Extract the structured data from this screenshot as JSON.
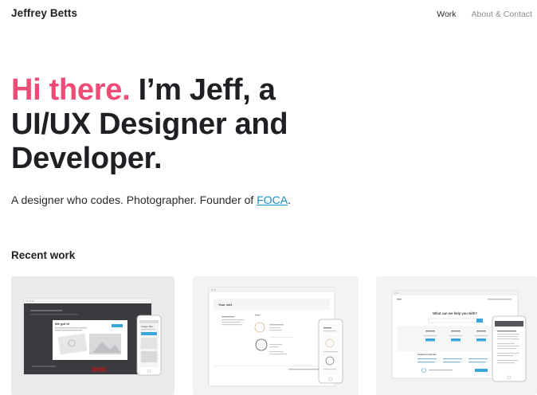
{
  "header": {
    "brand": "Jeffrey Betts",
    "nav": [
      {
        "label": "Work"
      },
      {
        "label": "About & Contact"
      }
    ]
  },
  "hero": {
    "greeting": "Hi there.",
    "line1_rest": " I’m Jeff, a",
    "line2": "UI/UX Designer and",
    "line3": "Developer."
  },
  "tagline": {
    "prefix": "A designer who codes. Photographer. Founder of ",
    "link": "FOCA",
    "suffix": "."
  },
  "recent": {
    "title": "Recent work",
    "projects": [
      {
        "mock_heading": "We got it!",
        "mock_subheading": "Image Title"
      },
      {
        "mock_heading": "Your cart"
      },
      {
        "mock_heading": "What can we help you with?",
        "mock_subheading": "Featured articles"
      }
    ]
  },
  "colors": {
    "accent": "#ee4c76",
    "link": "#1a8fc4",
    "text": "#1f1f24",
    "muted": "#8e8e93"
  }
}
